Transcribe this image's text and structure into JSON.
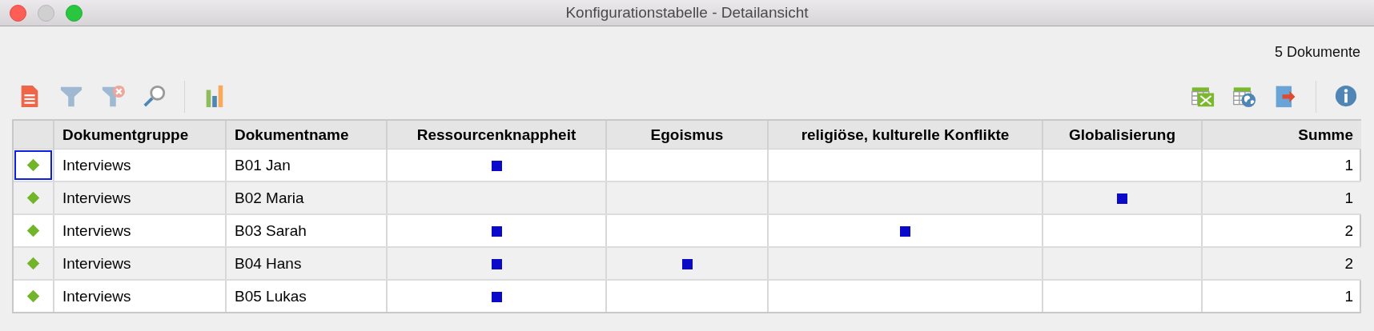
{
  "window": {
    "title": "Konfigurationstabelle - Detailansicht"
  },
  "document_count": "5 Dokumente",
  "table": {
    "columns": [
      "Dokumentgruppe",
      "Dokumentname",
      "Ressourcenknappheit",
      "Egoismus",
      "religiöse, kulturelle Konflikte",
      "Globalisierung",
      "Summe"
    ],
    "rows": [
      {
        "selected": true,
        "group": "Interviews",
        "name": "B01 Jan",
        "codes": [
          true,
          false,
          false,
          false
        ],
        "sum": "1"
      },
      {
        "selected": false,
        "group": "Interviews",
        "name": "B02 Maria",
        "codes": [
          false,
          false,
          false,
          true
        ],
        "sum": "1"
      },
      {
        "selected": false,
        "group": "Interviews",
        "name": "B03 Sarah",
        "codes": [
          true,
          false,
          true,
          false
        ],
        "sum": "2"
      },
      {
        "selected": false,
        "group": "Interviews",
        "name": "B04 Hans",
        "codes": [
          true,
          true,
          false,
          false
        ],
        "sum": "2"
      },
      {
        "selected": false,
        "group": "Interviews",
        "name": "B05 Lukas",
        "codes": [
          true,
          false,
          false,
          false
        ],
        "sum": "1"
      }
    ]
  }
}
